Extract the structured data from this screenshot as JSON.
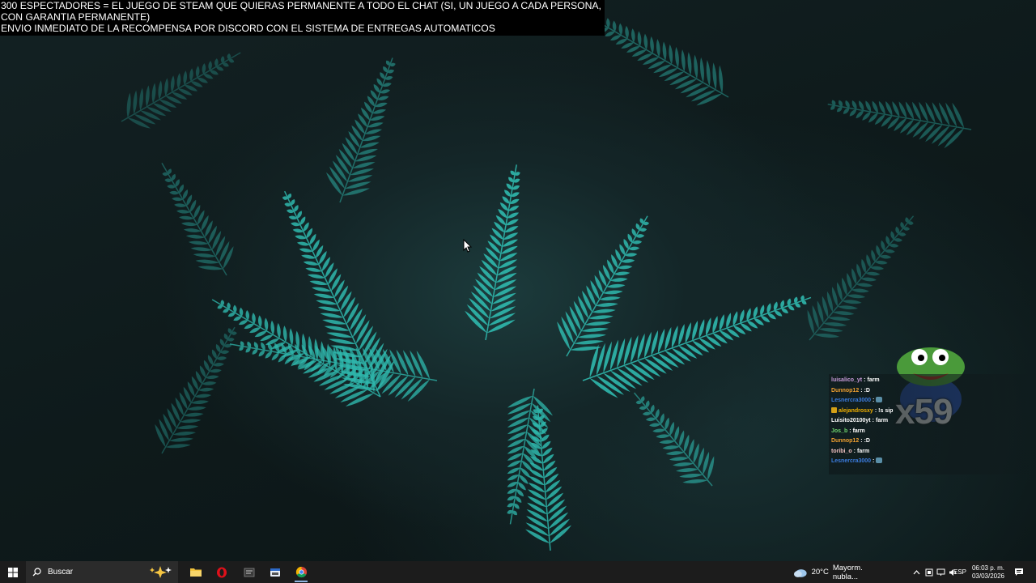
{
  "overlay": {
    "line1": "300 ESPECTADORES = EL JUEGO DE STEAM QUE QUIERAS PERMANENTE A TODO EL CHAT (SI, UN JUEGO A CADA PERSONA,",
    "line2": "CON GARANTIA PERMANENTE)",
    "line3": "ENVIO INMEDIATO DE LA RECOMPENSA POR DISCORD CON EL SISTEMA DE ENTREGAS AUTOMATICOS"
  },
  "chat": {
    "messages": [
      {
        "user": "luisalico_yt",
        "user_color": "#c79bd9",
        "sep": ":",
        "text": "farm",
        "emote": false,
        "badge": false
      },
      {
        "user": "Dunnop12",
        "user_color": "#f0a030",
        "sep": ":",
        "text": ":D",
        "emote": false,
        "badge": false
      },
      {
        "user": "Lesnercra3000",
        "user_color": "#3b7de0",
        "sep": ":",
        "text": "",
        "emote": true,
        "badge": false
      },
      {
        "user": "alejandrosxy",
        "user_color": "#f0b000",
        "sep": ":",
        "text": "!s sip",
        "emote": false,
        "badge": true
      },
      {
        "user": "Luisito20100yt",
        "user_color": "#ffffff",
        "sep": ":",
        "text": "farm",
        "emote": false,
        "badge": false
      },
      {
        "user": "Jos_b",
        "user_color": "#6fd66f",
        "sep": ":",
        "text": "farm",
        "emote": false,
        "badge": false
      },
      {
        "user": "Dunnop12",
        "user_color": "#f0a030",
        "sep": ":",
        "text": ":D",
        "emote": false,
        "badge": false
      },
      {
        "user": "toribi_o",
        "user_color": "#f0c0c0",
        "sep": ":",
        "text": "farm",
        "emote": false,
        "badge": false
      },
      {
        "user": "Lesnercra3000",
        "user_color": "#3b7de0",
        "sep": ":",
        "text": "",
        "emote": true,
        "badge": false
      }
    ],
    "combo_count": "x59"
  },
  "taskbar": {
    "search_placeholder": "Buscar",
    "apps": [
      {
        "name": "file-explorer-icon",
        "running": false
      },
      {
        "name": "opera-icon",
        "running": false
      },
      {
        "name": "app-icon-1",
        "running": false
      },
      {
        "name": "app-icon-2",
        "running": false
      },
      {
        "name": "chrome-icon",
        "running": true
      }
    ],
    "weather_temp": "20°C",
    "weather_desc": "Mayorm. nubla...",
    "language": "ESP",
    "time": "06:03 p. m.",
    "date": "03/03/2026"
  },
  "colors": {
    "taskbar_bg": "#1c1c1c",
    "fern": "#2fb8ad",
    "accent": "#8fb4e0"
  }
}
